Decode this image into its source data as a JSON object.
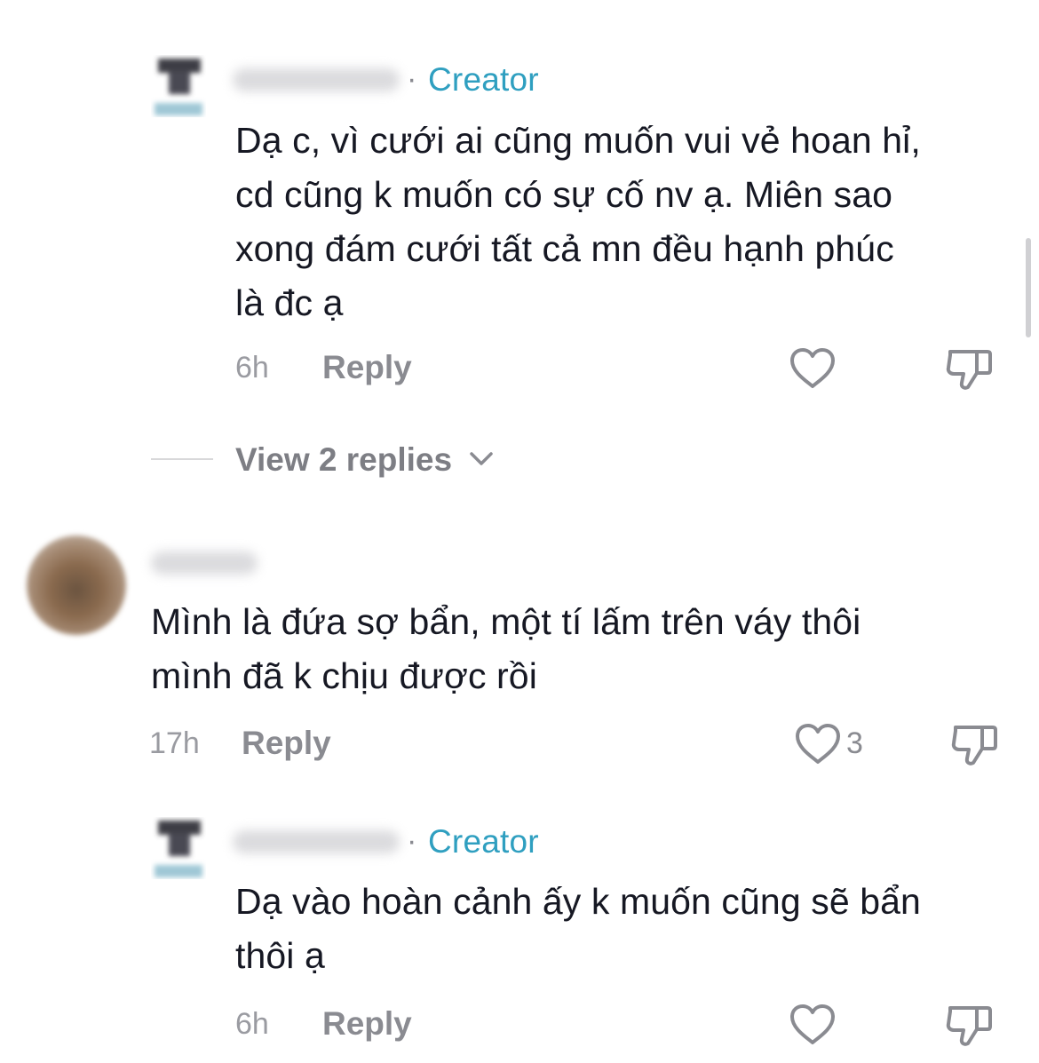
{
  "comments": [
    {
      "creator_badge": "Creator",
      "text": "Dạ c, vì cưới ai cũng muốn vui vẻ hoan hỉ,\ncd cũng k muốn có sự cố nv ạ. Miên sao\nxong đám cưới tất cả mn đều hạnh phúc\nlà đc ạ",
      "time": "6h",
      "reply_label": "Reply"
    },
    {
      "view_replies_label": "View 2 replies"
    },
    {
      "text": "Mình là đứa sợ bẩn, một tí lấm trên váy thôi\nmình đã k chịu được rồi",
      "time": "17h",
      "reply_label": "Reply",
      "like_count": "3"
    },
    {
      "creator_badge": "Creator",
      "text": "Dạ vào hoàn cảnh ấy k muốn cũng sẽ bẩn\nthôi ạ",
      "time": "6h",
      "reply_label": "Reply"
    }
  ],
  "colors": {
    "creator_accent": "#2f9fc0",
    "text_primary": "#161823",
    "text_secondary": "#8a8b91"
  },
  "icons": [
    "heart-icon",
    "dislike-icon",
    "chevron-down-icon"
  ]
}
